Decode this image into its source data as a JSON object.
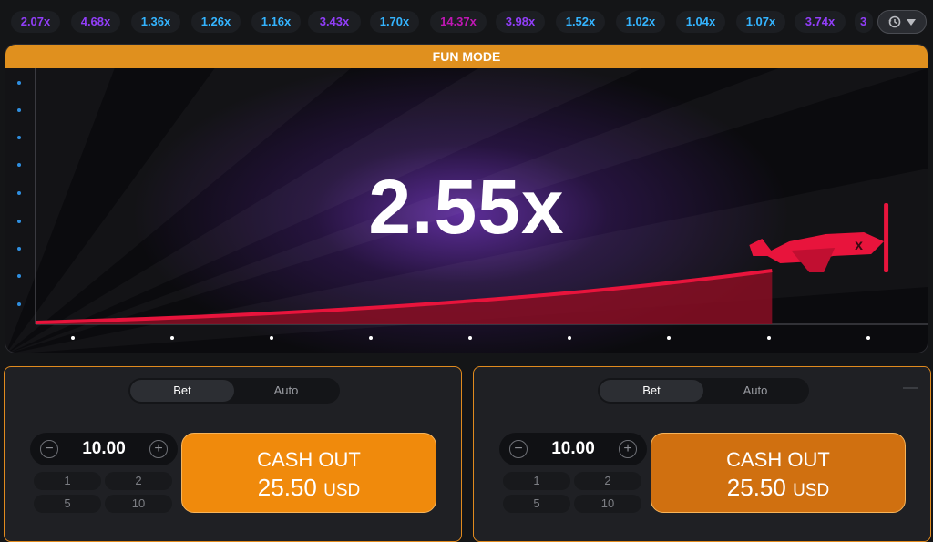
{
  "history": [
    {
      "value": "2.07x",
      "color": "#913ef8"
    },
    {
      "value": "4.68x",
      "color": "#913ef8"
    },
    {
      "value": "1.36x",
      "color": "#34b4ff"
    },
    {
      "value": "1.26x",
      "color": "#34b4ff"
    },
    {
      "value": "1.16x",
      "color": "#34b4ff"
    },
    {
      "value": "3.43x",
      "color": "#913ef8"
    },
    {
      "value": "1.70x",
      "color": "#34b4ff"
    },
    {
      "value": "14.37x",
      "color": "#c017b4"
    },
    {
      "value": "3.98x",
      "color": "#913ef8"
    },
    {
      "value": "1.52x",
      "color": "#34b4ff"
    },
    {
      "value": "1.02x",
      "color": "#34b4ff"
    },
    {
      "value": "1.04x",
      "color": "#34b4ff"
    },
    {
      "value": "1.07x",
      "color": "#34b4ff"
    },
    {
      "value": "3.74x",
      "color": "#913ef8"
    },
    {
      "value": "3",
      "color": "#913ef8"
    }
  ],
  "history_icons": [
    "history-icon",
    "chevron-down-icon"
  ],
  "game": {
    "banner": "FUN MODE",
    "multiplier": "2.55x",
    "accent": "#e8143c"
  },
  "panels": [
    {
      "tabs": [
        "Bet",
        "Auto"
      ],
      "active_tab": "Bet",
      "amount": "10.00",
      "quick": [
        "1",
        "2",
        "5",
        "10"
      ],
      "cashout_label": "CASH OUT",
      "cashout_amount": "25.50",
      "currency": "USD",
      "button_color": "#f08a0c"
    },
    {
      "tabs": [
        "Bet",
        "Auto"
      ],
      "active_tab": "Bet",
      "amount": "10.00",
      "quick": [
        "1",
        "2",
        "5",
        "10"
      ],
      "cashout_label": "CASH OUT",
      "cashout_amount": "25.50",
      "currency": "USD",
      "button_color": "#d07010"
    }
  ]
}
